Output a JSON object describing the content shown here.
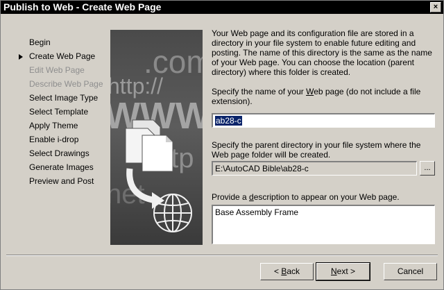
{
  "window": {
    "title": "Publish to Web - Create Web Page",
    "close_glyph": "×"
  },
  "nav": [
    {
      "label": "Begin",
      "state": "normal"
    },
    {
      "label": "Create Web Page",
      "state": "current"
    },
    {
      "label": "Edit Web Page",
      "state": "disabled"
    },
    {
      "label": "Describe Web Page",
      "state": "disabled"
    },
    {
      "label": "Select Image Type",
      "state": "normal"
    },
    {
      "label": "Select Template",
      "state": "normal"
    },
    {
      "label": "Apply Theme",
      "state": "normal"
    },
    {
      "label": "Enable i-drop",
      "state": "normal"
    },
    {
      "label": "Select Drawings",
      "state": "normal"
    },
    {
      "label": "Generate Images",
      "state": "normal"
    },
    {
      "label": "Preview and Post",
      "state": "normal"
    }
  ],
  "art": {
    "text_com": ".com",
    "text_http": "http://",
    "text_www": "WWW",
    "text_ftp": "ftp",
    "text_net": "net"
  },
  "main": {
    "intro": "Your Web page and its configuration file are stored in a directory in your file system to enable future editing and posting.  The name of this directory is the same as the name of your Web page.  You can choose the location (parent directory) where this folder is created.",
    "name_label_before": "Specify the name of your ",
    "name_label_mnemonic": "W",
    "name_label_after": "eb page (do not include a file extension).",
    "name_value": "ab28-c",
    "parent_label": "Specify the parent directory in your file system where the Web page folder will be created.",
    "parent_value": "E:\\AutoCAD Bible\\ab28-c",
    "browse_label": "...",
    "desc_label_before": "Provide a ",
    "desc_label_mnemonic": "d",
    "desc_label_after": "escription to appear on your Web page.",
    "desc_value": "Base Assembly Frame"
  },
  "buttons": {
    "back_pre": "< ",
    "back_mnemonic": "B",
    "back_post": "ack",
    "next_mnemonic": "N",
    "next_post": "ext >",
    "cancel": "Cancel"
  }
}
